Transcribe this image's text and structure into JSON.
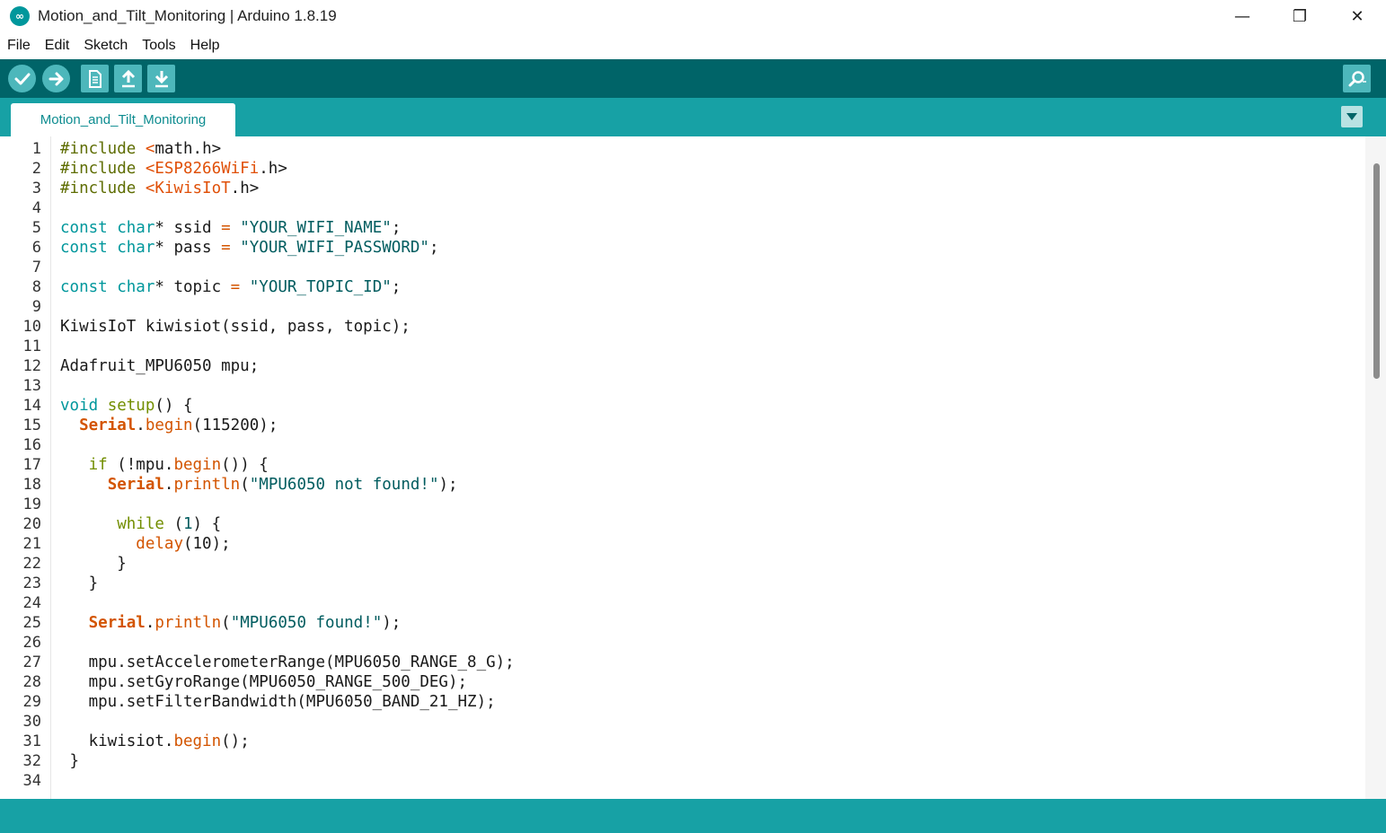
{
  "window": {
    "title": "Motion_and_Tilt_Monitoring | Arduino 1.8.19",
    "app_icon_glyph": "∞",
    "minimize_glyph": "—",
    "restore_glyph": "❐",
    "close_glyph": "✕"
  },
  "menu": [
    "File",
    "Edit",
    "Sketch",
    "Tools",
    "Help"
  ],
  "toolbar": {
    "buttons": [
      "verify-icon",
      "upload-icon",
      "new-icon",
      "open-icon",
      "save-icon",
      "serial-monitor-icon"
    ]
  },
  "tabs": [
    {
      "label": "Motion_and_Tilt_Monitoring"
    }
  ],
  "editor": {
    "line_numbers": [
      "1",
      "2",
      "3",
      "4",
      "5",
      "6",
      "7",
      "8",
      "9",
      "10",
      "11",
      "12",
      "13",
      "14",
      "15",
      "16",
      "17",
      "18",
      "19",
      "20",
      "21",
      "22",
      "23",
      "24",
      "25",
      "26",
      "27",
      "28",
      "29",
      "30",
      "31",
      "32",
      "34"
    ],
    "lines": [
      [
        [
          "#include ",
          "pre"
        ],
        [
          "<",
          "inc"
        ],
        [
          "math",
          "plain"
        ],
        [
          ".h>",
          "plain"
        ]
      ],
      [
        [
          "#include ",
          "pre"
        ],
        [
          "<ESP8266WiFi",
          "inc"
        ],
        [
          ".h>",
          "plain"
        ]
      ],
      [
        [
          "#include ",
          "pre"
        ],
        [
          "<KiwisIoT",
          "inc"
        ],
        [
          ".h>",
          "plain"
        ]
      ],
      [],
      [
        [
          "const ",
          "type"
        ],
        [
          "char",
          "type"
        ],
        [
          "* ssid ",
          "plain"
        ],
        [
          "=",
          "op"
        ],
        [
          " \"YOUR_WIFI_NAME\"",
          "str"
        ],
        [
          ";",
          "plain"
        ]
      ],
      [
        [
          "const ",
          "type"
        ],
        [
          "char",
          "type"
        ],
        [
          "* pass ",
          "plain"
        ],
        [
          "=",
          "op"
        ],
        [
          " \"YOUR_WIFI_PASSWORD\"",
          "str"
        ],
        [
          ";",
          "plain"
        ]
      ],
      [],
      [
        [
          "const ",
          "type"
        ],
        [
          "char",
          "type"
        ],
        [
          "* topic ",
          "plain"
        ],
        [
          "=",
          "op"
        ],
        [
          " \"YOUR_TOPIC_ID\"",
          "str"
        ],
        [
          ";",
          "plain"
        ]
      ],
      [],
      [
        [
          "KiwisIoT kiwisiot(ssid, pass, topic);",
          "plain"
        ]
      ],
      [],
      [
        [
          "Adafruit_MPU6050 mpu;",
          "plain"
        ]
      ],
      [],
      [
        [
          "void ",
          "type"
        ],
        [
          "setup",
          "ctl"
        ],
        [
          "() {",
          "plain"
        ]
      ],
      [
        [
          "  ",
          "plain"
        ],
        [
          "Serial",
          "cls"
        ],
        [
          ".",
          "plain"
        ],
        [
          "begin",
          "fn"
        ],
        [
          "(115200);",
          "plain"
        ]
      ],
      [],
      [
        [
          "   ",
          "plain"
        ],
        [
          "if",
          "ctl"
        ],
        [
          " (!mpu.",
          "plain"
        ],
        [
          "begin",
          "fn"
        ],
        [
          "()) {",
          "plain"
        ]
      ],
      [
        [
          "     ",
          "plain"
        ],
        [
          "Serial",
          "cls"
        ],
        [
          ".",
          "plain"
        ],
        [
          "println",
          "fn"
        ],
        [
          "(",
          "plain"
        ],
        [
          "\"MPU6050 not found!\"",
          "str"
        ],
        [
          ");",
          "plain"
        ]
      ],
      [],
      [
        [
          "      ",
          "plain"
        ],
        [
          "while",
          "ctl"
        ],
        [
          " (",
          "plain"
        ],
        [
          "1",
          "num"
        ],
        [
          ") {",
          "plain"
        ]
      ],
      [
        [
          "        ",
          "plain"
        ],
        [
          "delay",
          "fn"
        ],
        [
          "(10);",
          "plain"
        ]
      ],
      [
        [
          "      }",
          "plain"
        ]
      ],
      [
        [
          "   }",
          "plain"
        ]
      ],
      [],
      [
        [
          "   ",
          "plain"
        ],
        [
          "Serial",
          "cls"
        ],
        [
          ".",
          "plain"
        ],
        [
          "println",
          "fn"
        ],
        [
          "(",
          "plain"
        ],
        [
          "\"MPU6050 found!\"",
          "str"
        ],
        [
          ");",
          "plain"
        ]
      ],
      [],
      [
        [
          "   mpu.setAccelerometerRange(MPU6050_RANGE_8_G);",
          "plain"
        ]
      ],
      [
        [
          "   mpu.setGyroRange(MPU6050_RANGE_500_DEG);",
          "plain"
        ]
      ],
      [
        [
          "   mpu.setFilterBandwidth(MPU6050_BAND_21_HZ);",
          "plain"
        ]
      ],
      [],
      [
        [
          "   kiwisiot.",
          "plain"
        ],
        [
          "begin",
          "fn"
        ],
        [
          "();",
          "plain"
        ]
      ],
      [
        [
          " }",
          "plain"
        ]
      ],
      []
    ]
  },
  "colors": {
    "toolbar_bg": "#006468",
    "tabbar_bg": "#17a1a5",
    "accent": "#00979c"
  }
}
